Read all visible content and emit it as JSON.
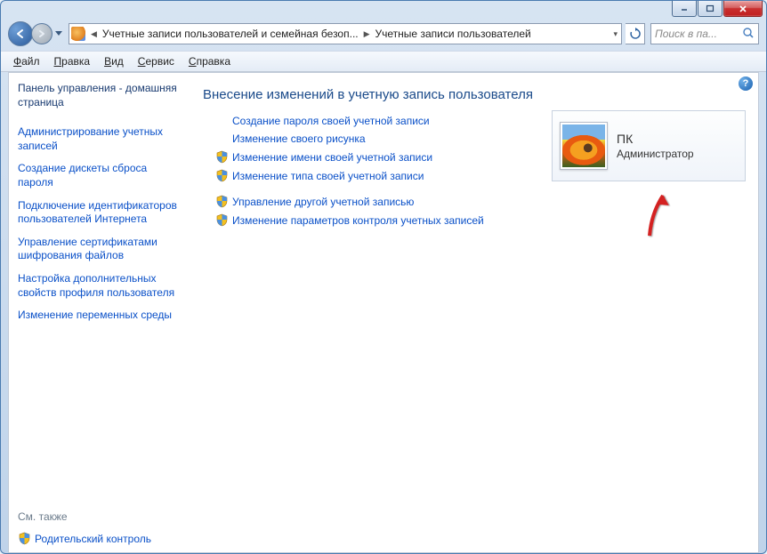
{
  "window": {
    "controls": {
      "min": "—",
      "max": "◻"
    }
  },
  "breadcrumbs": {
    "item1": "Учетные записи пользователей и семейная безоп...",
    "item2": "Учетные записи пользователей"
  },
  "search": {
    "placeholder": "Поиск в па..."
  },
  "menu": {
    "file": "айл",
    "file_u": "Ф",
    "edit": "равка",
    "edit_u": "П",
    "view": "ид",
    "view_u": "В",
    "service": "ервис",
    "service_u": "С",
    "help": "правка",
    "help_u": "С"
  },
  "sidebar": {
    "home": "Панель управления - домашняя страница",
    "links": [
      "Администрирование учетных записей",
      "Создание дискеты сброса пароля",
      "Подключение идентификаторов пользователей Интернета",
      "Управление сертификатами шифрования файлов",
      "Настройка дополнительных свойств профиля пользователя",
      "Изменение переменных среды"
    ],
    "see_also_label": "См. также",
    "see_also_item": "Родительский контроль"
  },
  "main": {
    "heading": "Внесение изменений в учетную запись пользователя",
    "tasks1": [
      {
        "shield": false,
        "label": "Создание пароля своей учетной записи"
      },
      {
        "shield": false,
        "label": "Изменение своего рисунка"
      },
      {
        "shield": true,
        "label": "Изменение имени своей учетной записи"
      },
      {
        "shield": true,
        "label": "Изменение типа своей учетной записи"
      }
    ],
    "tasks2": [
      {
        "shield": true,
        "label": "Управление другой учетной записью"
      },
      {
        "shield": true,
        "label": "Изменение параметров контроля учетных записей"
      }
    ]
  },
  "user": {
    "name": "ПК",
    "role": "Администратор"
  }
}
